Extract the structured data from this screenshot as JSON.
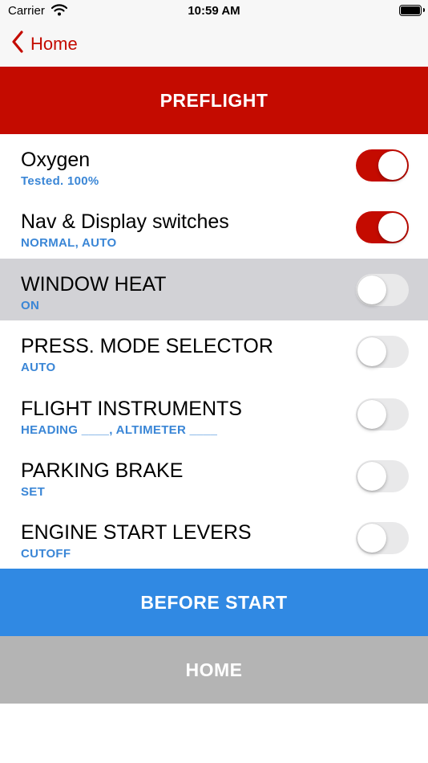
{
  "status_bar": {
    "carrier": "Carrier",
    "time": "10:59 AM"
  },
  "nav": {
    "back_label": "Home"
  },
  "header": {
    "title": "PREFLIGHT"
  },
  "items": [
    {
      "title": "Oxygen",
      "subtitle": "Tested. 100%",
      "checked": true
    },
    {
      "title": "Nav & Display switches",
      "subtitle": "NORMAL, AUTO",
      "checked": true
    },
    {
      "title": "WINDOW HEAT",
      "subtitle": "ON",
      "checked": false,
      "highlighted": true
    },
    {
      "title": "PRESS. MODE SELECTOR",
      "subtitle": "AUTO",
      "checked": false
    },
    {
      "title": "FLIGHT INSTRUMENTS",
      "subtitle": "HEADING ____, ALTIMETER ____",
      "checked": false
    },
    {
      "title": "PARKING BRAKE",
      "subtitle": "SET",
      "checked": false
    },
    {
      "title": "ENGINE START LEVERS",
      "subtitle": "CUTOFF",
      "checked": false
    }
  ],
  "footer": {
    "next_label": "BEFORE START",
    "home_label": "HOME"
  },
  "colors": {
    "accent_red": "#c40b00",
    "accent_blue": "#3089e3",
    "subtitle_blue": "#3a86d6",
    "home_gray": "#b4b4b4",
    "highlight_gray": "#d2d2d6"
  },
  "icons": {
    "back": "chevron-left-icon",
    "wifi": "wifi-icon",
    "battery": "battery-icon"
  }
}
